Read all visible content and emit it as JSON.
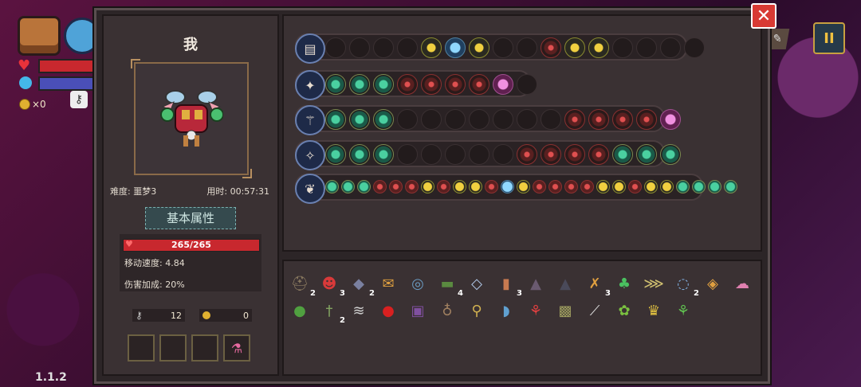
{
  "hud": {
    "coins": "×0",
    "version": "1.1.2",
    "pause_label": "II",
    "close_label": "✕"
  },
  "character": {
    "name": "我",
    "difficulty": "难度: 噩梦3",
    "time": "用时: 00:57:31",
    "attr_title": "基本属性",
    "hp": "265/265",
    "move_speed": "移动速度: 4.84",
    "damage_bonus": "伤害加成: 20%",
    "keys": "12",
    "gold": "0"
  },
  "weapons": [
    {
      "icon": "chest-icon",
      "cells": [
        "e",
        "e",
        "e",
        "e",
        "y",
        "b",
        "y",
        "e",
        "e",
        "r",
        "y",
        "y",
        "e",
        "e",
        "e",
        "e"
      ]
    },
    {
      "icon": "crystal-icon",
      "cells": [
        "g",
        "g",
        "g",
        "r",
        "r",
        "r",
        "r",
        "p",
        "e"
      ]
    },
    {
      "icon": "staff-icon",
      "cells": [
        "g",
        "g",
        "g",
        "e",
        "e",
        "e",
        "e",
        "e",
        "e",
        "e",
        "r",
        "r",
        "r",
        "r",
        "p"
      ]
    },
    {
      "icon": "wand-icon",
      "cells": [
        "g",
        "g",
        "g",
        "e",
        "e",
        "e",
        "e",
        "e",
        "r",
        "r",
        "r",
        "r",
        "g",
        "g",
        "g"
      ]
    },
    {
      "icon": "branch-icon",
      "cells": [
        "g",
        "g",
        "g",
        "r",
        "r",
        "r",
        "y",
        "r",
        "y",
        "y",
        "r",
        "b",
        "y",
        "r",
        "r",
        "r",
        "r",
        "y",
        "y",
        "r",
        "y",
        "y",
        "g",
        "g",
        "g",
        "g"
      ]
    }
  ],
  "items": [
    {
      "icon": "hat-icon",
      "count": "2",
      "color": "#8a7a60",
      "glyph": "⛑"
    },
    {
      "icon": "demon-mask-icon",
      "count": "3",
      "color": "#d83a3a",
      "glyph": "☻"
    },
    {
      "icon": "armor-icon",
      "count": "2",
      "color": "#7a80a0",
      "glyph": "◆"
    },
    {
      "icon": "scroll-icon",
      "count": "",
      "color": "#e0a040",
      "glyph": "✉"
    },
    {
      "icon": "globe-icon",
      "count": "",
      "color": "#6a9ac0",
      "glyph": "◎"
    },
    {
      "icon": "belt-icon",
      "count": "4",
      "color": "#5a8a40",
      "glyph": "▬"
    },
    {
      "icon": "diamond-icon",
      "count": "",
      "color": "#b0c8e8",
      "glyph": "◇"
    },
    {
      "icon": "boot-icon",
      "count": "3",
      "color": "#c87a50",
      "glyph": "▮"
    },
    {
      "icon": "cloak-icon",
      "count": "",
      "color": "#6a5a70",
      "glyph": "▲"
    },
    {
      "icon": "robe-icon",
      "count": "",
      "color": "#4a4a5a",
      "glyph": "▲"
    },
    {
      "icon": "pickaxe-icon",
      "count": "3",
      "color": "#e0a040",
      "glyph": "✗"
    },
    {
      "icon": "clover-icon",
      "count": "",
      "color": "#4ac060",
      "glyph": "♣"
    },
    {
      "icon": "claw-icon",
      "count": "",
      "color": "#d0c070",
      "glyph": "⋙"
    },
    {
      "icon": "ring-icon",
      "count": "2",
      "color": "#80b0e0",
      "glyph": "◌"
    },
    {
      "icon": "gem-icon",
      "count": "",
      "color": "#e0a040",
      "glyph": "◈"
    },
    {
      "icon": "brain-icon",
      "count": "",
      "color": "#e080b0",
      "glyph": "☁"
    },
    {
      "icon": "frog-icon",
      "count": "",
      "color": "#50a040",
      "glyph": "●"
    },
    {
      "icon": "sword-icon",
      "count": "2",
      "color": "#80a060",
      "glyph": "†"
    },
    {
      "icon": "teeth-icon",
      "count": "",
      "color": "#d0d0d0",
      "glyph": "≋"
    },
    {
      "icon": "red-orb-icon",
      "count": "",
      "color": "#d82020",
      "glyph": "●"
    },
    {
      "icon": "tome-icon",
      "count": "",
      "color": "#8050a0",
      "glyph": "▣"
    },
    {
      "icon": "bottle-icon",
      "count": "",
      "color": "#a08060",
      "glyph": "♁"
    },
    {
      "icon": "magnifier-icon",
      "count": "",
      "color": "#d0b050",
      "glyph": "⚲"
    },
    {
      "icon": "fish-icon",
      "count": "",
      "color": "#60a0d0",
      "glyph": "◗"
    },
    {
      "icon": "scythe-icon",
      "count": "",
      "color": "#e04040",
      "glyph": "⚘"
    },
    {
      "icon": "chest-armor-icon",
      "count": "",
      "color": "#a0a060",
      "glyph": "▩"
    },
    {
      "icon": "blade-icon",
      "count": "",
      "color": "#e0e0e0",
      "glyph": "⟋"
    },
    {
      "icon": "leaf-icon",
      "count": "",
      "color": "#7ac040",
      "glyph": "✿"
    },
    {
      "icon": "crown-flame-icon",
      "count": "",
      "color": "#e0c040",
      "glyph": "♛"
    },
    {
      "icon": "sprout-icon",
      "count": "",
      "color": "#60c050",
      "glyph": "⚘"
    }
  ]
}
